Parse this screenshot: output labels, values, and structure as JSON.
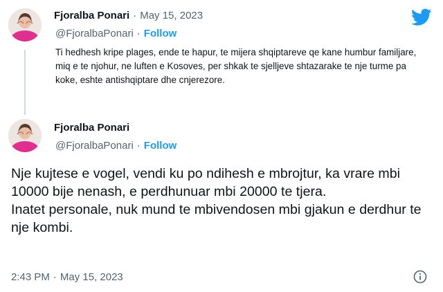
{
  "tweet1": {
    "name": "Fjoralba Ponari",
    "separator": "·",
    "date": "May 15, 2023",
    "handle": "@FjoralbaPonari",
    "follow_separator": "·",
    "follow_label": "Follow",
    "text": "Ti hedhesh kripe plages, ende te hapur, te mijera shqiptareve qe kane humbur familjare, miq e te njohur, ne luften e Kosoves, per shkak te sjelljeve shtazarake te nje turme pa koke, eshte antishqiptare dhe cnjerezore."
  },
  "tweet2": {
    "name": "Fjoralba Ponari",
    "handle": "@FjoralbaPonari",
    "follow_separator": "·",
    "follow_label": "Follow",
    "paragraph1": "Nje kujtese e vogel, vendi ku po ndihesh e mbrojtur, ka vrare mbi 10000 bije nenash, e perdhunuar mbi 20000 te tjera.",
    "paragraph2": "Inatet personale, nuk mund te mbivendosen mbi gjakun e derdhur te nje kombi.",
    "time": "2:43 PM",
    "footer_separator": "·",
    "date": "May 15, 2023"
  },
  "icons": {
    "logo": "twitter-bird-icon",
    "info": "info-icon"
  },
  "colors": {
    "accent": "#1d9bf0",
    "muted": "#536471",
    "text": "#0f1419",
    "avatar_outfit": "#e0308f"
  }
}
